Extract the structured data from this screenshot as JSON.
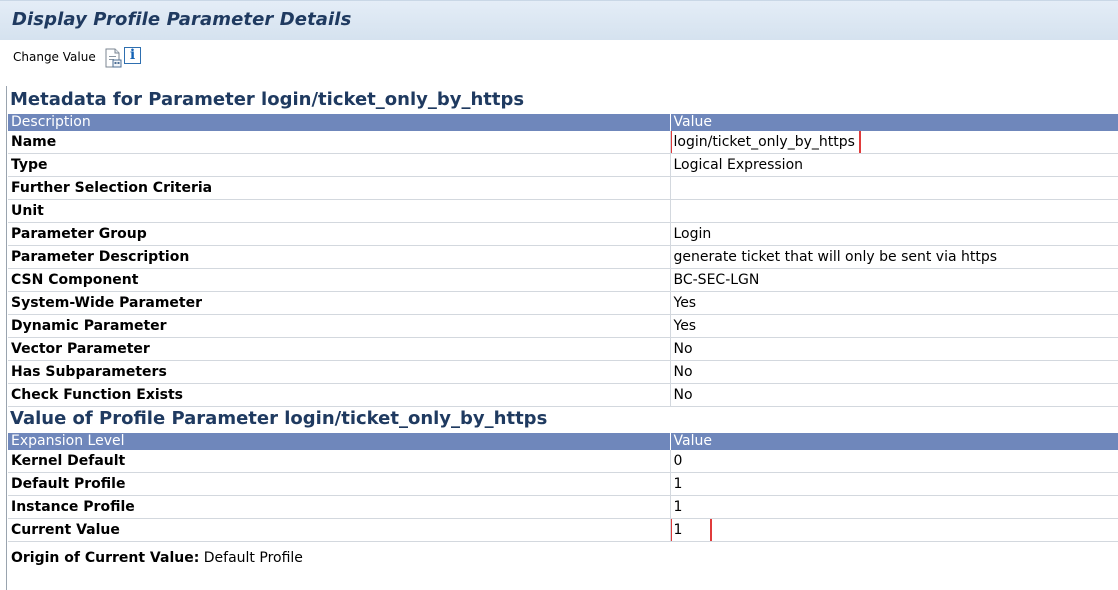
{
  "window": {
    "title": "Display Profile Parameter Details"
  },
  "toolbar": {
    "change_value_label": "Change Value",
    "icons": [
      "document-icon",
      "info-icon"
    ],
    "info_glyph": "i"
  },
  "metadata": {
    "header": "Metadata for Parameter login/ticket_only_by_https",
    "columns": [
      "Description",
      "Value"
    ],
    "rows": [
      {
        "key": "Name",
        "value": "login/ticket_only_by_https"
      },
      {
        "key": "Type",
        "value": "Logical Expression"
      },
      {
        "key": "Further Selection Criteria",
        "value": ""
      },
      {
        "key": "Unit",
        "value": ""
      },
      {
        "key": "Parameter Group",
        "value": "Login"
      },
      {
        "key": "Parameter Description",
        "value": "generate ticket that will only be sent via https"
      },
      {
        "key": "CSN Component",
        "value": "BC-SEC-LGN"
      },
      {
        "key": "System-Wide Parameter",
        "value": "Yes"
      },
      {
        "key": "Dynamic Parameter",
        "value": "Yes"
      },
      {
        "key": "Vector Parameter",
        "value": "No"
      },
      {
        "key": "Has Subparameters",
        "value": "No"
      },
      {
        "key": "Check Function Exists",
        "value": "No"
      }
    ]
  },
  "values": {
    "header": "Value of Profile Parameter login/ticket_only_by_https",
    "columns": [
      "Expansion Level",
      "Value"
    ],
    "rows": [
      {
        "key": "Kernel Default",
        "value": "0"
      },
      {
        "key": "Default Profile",
        "value": "1"
      },
      {
        "key": "Instance Profile",
        "value": "1"
      },
      {
        "key": "Current Value",
        "value": "1"
      }
    ]
  },
  "origin": {
    "label": "Origin of Current Value:",
    "value": "Default Profile"
  },
  "colors": {
    "title": "#1f3a60",
    "table_header_bg": "#6f87bb",
    "highlight_box": "#e03b3b"
  }
}
